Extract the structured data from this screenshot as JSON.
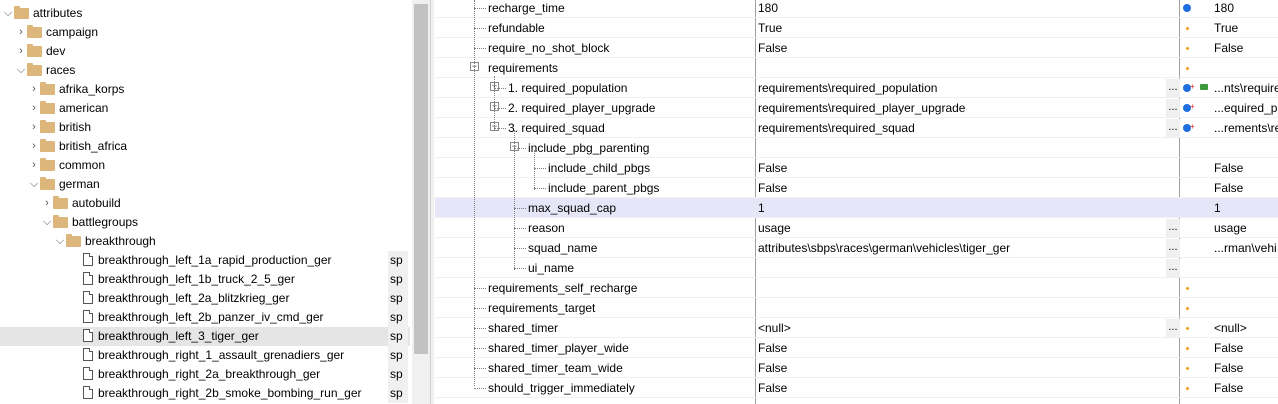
{
  "tree": {
    "items": [
      {
        "label": "attributes",
        "type": "folder",
        "expanded": true,
        "indent": 0
      },
      {
        "label": "campaign",
        "type": "folder",
        "expanded": false,
        "indent": 1
      },
      {
        "label": "dev",
        "type": "folder",
        "expanded": false,
        "indent": 1
      },
      {
        "label": "races",
        "type": "folder",
        "expanded": true,
        "indent": 1
      },
      {
        "label": "afrika_korps",
        "type": "folder",
        "expanded": false,
        "indent": 2
      },
      {
        "label": "american",
        "type": "folder",
        "expanded": false,
        "indent": 2
      },
      {
        "label": "british",
        "type": "folder",
        "expanded": false,
        "indent": 2
      },
      {
        "label": "british_africa",
        "type": "folder",
        "expanded": false,
        "indent": 2
      },
      {
        "label": "common",
        "type": "folder",
        "expanded": false,
        "indent": 2
      },
      {
        "label": "german",
        "type": "folder",
        "expanded": true,
        "indent": 2
      },
      {
        "label": "autobuild",
        "type": "folder",
        "expanded": false,
        "indent": 3
      },
      {
        "label": "battlegroups",
        "type": "folder",
        "expanded": true,
        "indent": 3
      },
      {
        "label": "breakthrough",
        "type": "folder",
        "expanded": true,
        "indent": 4
      },
      {
        "label": "breakthrough_left_1a_rapid_production_ger",
        "type": "file",
        "suffix": "sp",
        "indent": 5
      },
      {
        "label": "breakthrough_left_1b_truck_2_5_ger",
        "type": "file",
        "suffix": "sp",
        "indent": 5
      },
      {
        "label": "breakthrough_left_2a_blitzkrieg_ger",
        "type": "file",
        "suffix": "sp",
        "indent": 5
      },
      {
        "label": "breakthrough_left_2b_panzer_iv_cmd_ger",
        "type": "file",
        "suffix": "sp",
        "indent": 5
      },
      {
        "label": "breakthrough_left_3_tiger_ger",
        "type": "file",
        "suffix": "sp",
        "indent": 5,
        "selected": true
      },
      {
        "label": "breakthrough_right_1_assault_grenadiers_ger",
        "type": "file",
        "suffix": "sp",
        "indent": 5
      },
      {
        "label": "breakthrough_right_2a_breakthrough_ger",
        "type": "file",
        "suffix": "sp",
        "indent": 5
      },
      {
        "label": "breakthrough_right_2b_smoke_bombing_run_ger",
        "type": "file",
        "suffix": "sp",
        "indent": 5
      }
    ]
  },
  "grid": {
    "rows": [
      {
        "name": "recharge_time",
        "value": "180",
        "value2": "180",
        "marker": "blue",
        "level": 0
      },
      {
        "name": "refundable",
        "value": "True",
        "value2": "True",
        "marker": "orange",
        "level": 0
      },
      {
        "name": "require_no_shot_block",
        "value": "False",
        "value2": "False",
        "marker": "orange",
        "level": 0
      },
      {
        "name": "requirements",
        "value": "",
        "value2": "",
        "marker": "orange",
        "level": 0,
        "toggle": "−"
      },
      {
        "name": "1. required_population",
        "value": "requirements\\required_population",
        "value2": "...nts\\require",
        "marker": "blue-plus-chat",
        "level": 1,
        "toggle": "+",
        "ellipsis": true
      },
      {
        "name": "2. required_player_upgrade",
        "value": "requirements\\required_player_upgrade",
        "value2": "...equired_pl",
        "marker": "blue-plus",
        "level": 1,
        "toggle": "+",
        "ellipsis": true
      },
      {
        "name": "3. required_squad",
        "value": "requirements\\required_squad",
        "value2": "...rements\\re",
        "marker": "blue-plus",
        "level": 1,
        "toggle": "−",
        "ellipsis": true
      },
      {
        "name": "include_pbg_parenting",
        "value": "",
        "value2": "",
        "marker": "",
        "level": 2,
        "toggle": "−"
      },
      {
        "name": "include_child_pbgs",
        "value": "False",
        "value2": "False",
        "marker": "",
        "level": 3
      },
      {
        "name": "include_parent_pbgs",
        "value": "False",
        "value2": "False",
        "marker": "",
        "level": 3
      },
      {
        "name": "max_squad_cap",
        "value": "1",
        "value2": "1",
        "marker": "",
        "level": 2,
        "selected": true
      },
      {
        "name": "reason",
        "value": "usage",
        "value2": "usage",
        "marker": "",
        "level": 2,
        "ellipsis": true
      },
      {
        "name": "squad_name",
        "value": "attributes\\sbps\\races\\german\\vehicles\\tiger_ger",
        "value2": "...rman\\vehi",
        "marker": "",
        "level": 2,
        "ellipsis": true
      },
      {
        "name": "ui_name",
        "value": "",
        "value2": "",
        "marker": "",
        "level": 2,
        "ellipsis": true
      },
      {
        "name": "requirements_self_recharge",
        "value": "",
        "value2": "",
        "marker": "orange",
        "level": 0
      },
      {
        "name": "requirements_target",
        "value": "",
        "value2": "",
        "marker": "orange",
        "level": 0
      },
      {
        "name": "shared_timer",
        "value": "<null>",
        "value2": "<null>",
        "marker": "orange",
        "level": 0,
        "ellipsis": true
      },
      {
        "name": "shared_timer_player_wide",
        "value": "False",
        "value2": "False",
        "marker": "orange",
        "level": 0
      },
      {
        "name": "shared_timer_team_wide",
        "value": "False",
        "value2": "False",
        "marker": "orange",
        "level": 0
      },
      {
        "name": "should_trigger_immediately",
        "value": "False",
        "value2": "False",
        "marker": "orange",
        "level": 0
      }
    ]
  },
  "colors": {
    "accent_blue": "#1e6fe0",
    "marker_orange": "#f0a020",
    "selection": "#e6e6f8"
  }
}
